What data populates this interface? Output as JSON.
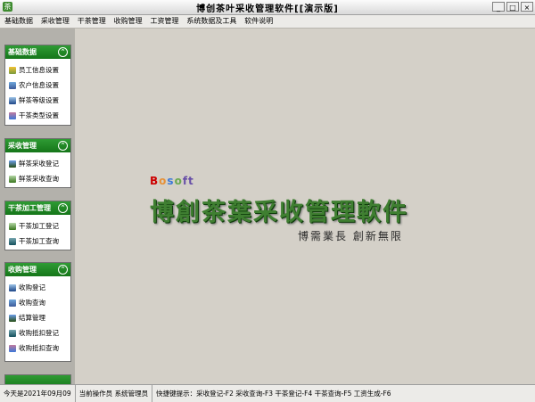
{
  "window": {
    "title": "博创茶叶采收管理软件[[演示版]",
    "minimize": "_",
    "maximize": "□",
    "close": "×"
  },
  "menu": [
    "基础数据",
    "采收管理",
    "干茶管理",
    "收购管理",
    "工资管理",
    "系统数据及工具",
    "软件说明"
  ],
  "sidebar": {
    "collapse_glyph": "⌃",
    "panels": [
      {
        "title": "基础数据",
        "items": [
          "员工信息设置",
          "农户信息设置",
          "鲜茶等级设置",
          "干茶类型设置"
        ]
      },
      {
        "title": "采收管理",
        "items": [
          "鲜茶采收登记",
          "鲜茶采收查询"
        ]
      },
      {
        "title": "干茶加工管理",
        "items": [
          "干茶加工登记",
          "干茶加工查询"
        ]
      },
      {
        "title": "收购管理",
        "items": [
          "收购登记",
          "收购查询",
          "结算管理",
          "收购抵扣登记",
          "收购抵扣查询"
        ]
      }
    ]
  },
  "logo": {
    "brand": [
      "B",
      "o",
      "s",
      "o",
      "ft"
    ],
    "title": "博創茶葉采收管理軟件",
    "slogan": "博需業長  創新無限"
  },
  "status": {
    "date": "今天是2021年09月09",
    "operator": "当前操作员 系统管理员",
    "shortcuts": "快捷键提示：采收登记-F2 采收查询-F3 干茶登记-F4 干茶查询-F5 工资生成-F6"
  }
}
